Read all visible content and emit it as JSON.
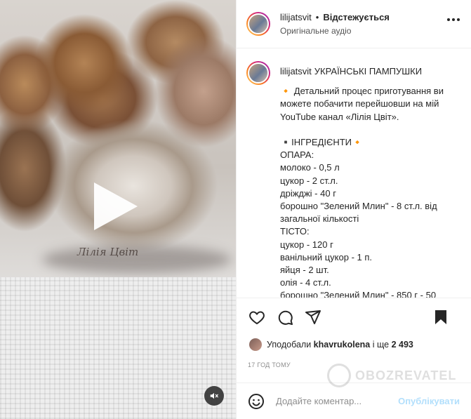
{
  "post": {
    "username": "lilijatsvit",
    "separator": "•",
    "follow_label": "Відстежується",
    "audio_label": "Оригінальне аудіо",
    "more_icon": "more-horizontal-icon"
  },
  "media": {
    "watermark_text": "Лілія Цвіт",
    "play_icon": "play-icon",
    "mute_icon": "speaker-muted-icon"
  },
  "caption": {
    "username": "lilijatsvit",
    "title": "УКРАЇНСЬКІ ПАМПУШКИ",
    "lines": [
      "🔸 Детальний процес приготування ви можете побачити перейшовши на мій YouTube канал «Лілія Цвіт».",
      "",
      "▪️ІНГРЕДІЄНТИ🔸",
      "ОПАРА:",
      "молоко - 0,5 л",
      "цукор - 2 ст.л.",
      "дріжджі - 40 г",
      "борошно \"Зелений Млин\" - 8 ст.л. від загальної кількості",
      "ТІСТО:",
      "цукор - 120 г",
      "ванільний цукор - 1 п.",
      "яйця - 2 шт.",
      "олія - 4 ст.л.",
      "борошно \"Зелений Млин\" - 850 г - 50"
    ]
  },
  "actions": {
    "like_icon": "heart-icon",
    "comment_icon": "comment-icon",
    "share_icon": "paper-plane-icon",
    "save_icon": "bookmark-icon"
  },
  "likes": {
    "prefix": "Уподобали",
    "user": "khavrukolena",
    "suffix_pre": "і ще",
    "count": "2 493"
  },
  "timestamp": "17 ГОД ТОМУ",
  "watermark": "OBOZREVATEL",
  "comment": {
    "placeholder": "Додайте коментар...",
    "post_label": "Опублікувати",
    "emoji_icon": "smiley-icon"
  }
}
